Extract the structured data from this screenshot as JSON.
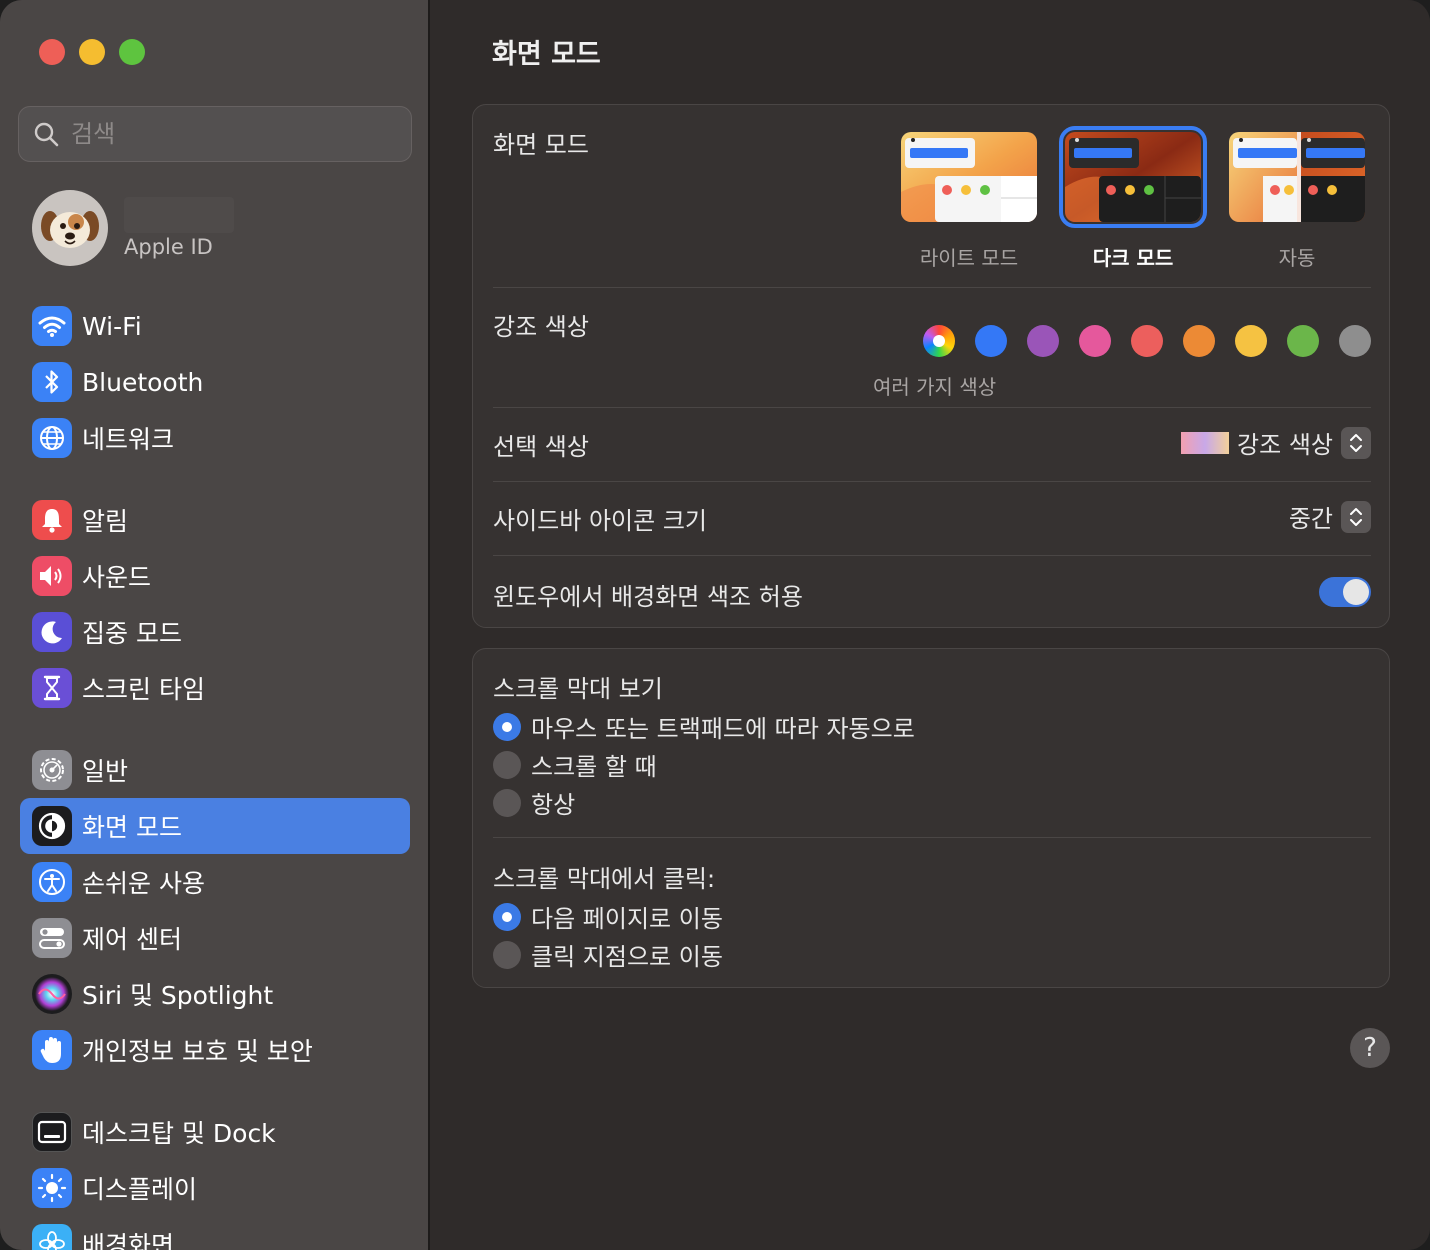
{
  "window": {
    "title": "화면 모드"
  },
  "search": {
    "placeholder": "검색"
  },
  "account": {
    "label": "Apple ID"
  },
  "sidebar": {
    "items": [
      {
        "label": "Wi-Fi",
        "icon": "wifi-icon",
        "color": "#3b82f6"
      },
      {
        "label": "Bluetooth",
        "icon": "bluetooth-icon",
        "color": "#3b82f6"
      },
      {
        "label": "네트워크",
        "icon": "globe-icon",
        "color": "#3b82f6"
      },
      {
        "label": "알림",
        "icon": "bell-icon",
        "color": "#ee4d4d"
      },
      {
        "label": "사운드",
        "icon": "speaker-icon",
        "color": "#ee4d66"
      },
      {
        "label": "집중 모드",
        "icon": "moon-icon",
        "color": "#5a4fd6"
      },
      {
        "label": "스크린 타임",
        "icon": "hourglass-icon",
        "color": "#6a4fd6"
      },
      {
        "label": "일반",
        "icon": "gear-icon",
        "color": "#8e8e93"
      },
      {
        "label": "화면 모드",
        "icon": "appearance-icon",
        "color": "#1c1c1e"
      },
      {
        "label": "손쉬운 사용",
        "icon": "accessibility-icon",
        "color": "#3b82f6"
      },
      {
        "label": "제어 센터",
        "icon": "toggles-icon",
        "color": "#8e8e93"
      },
      {
        "label": "Siri 및 Spotlight",
        "icon": "siri-icon",
        "color": "#a03fd6"
      },
      {
        "label": "개인정보 보호 및 보안",
        "icon": "hand-icon",
        "color": "#3b82f6"
      },
      {
        "label": "데스크탑 및 Dock",
        "icon": "dock-icon",
        "color": "#1c1c1e"
      },
      {
        "label": "디스플레이",
        "icon": "sun-icon",
        "color": "#3b82f6"
      },
      {
        "label": "배경화면",
        "icon": "flower-icon",
        "color": "#3bb0f6"
      }
    ],
    "active_index": 8
  },
  "appearance": {
    "label": "화면 모드",
    "options": [
      {
        "label": "라이트 모드",
        "selected": false
      },
      {
        "label": "다크 모드",
        "selected": true
      },
      {
        "label": "자동",
        "selected": false
      }
    ]
  },
  "accent": {
    "label": "강조 색상",
    "caption": "여러 가지 색상",
    "colors": [
      "multicolor",
      "#3478f6",
      "#9a55b8",
      "#e5589c",
      "#ec5f5d",
      "#ec8a35",
      "#f5c242",
      "#6bb64a",
      "#8e8e8e"
    ]
  },
  "highlight": {
    "label": "선택 색상",
    "value": "강조 색상"
  },
  "sidebar_icon_size": {
    "label": "사이드바 아이콘 크기",
    "value": "중간"
  },
  "wallpaper_tinting": {
    "label": "윈도우에서 배경화면 색조 허용",
    "enabled": true
  },
  "scrollbars": {
    "label": "스크롤 막대 보기",
    "options": [
      {
        "label": "마우스 또는 트랙패드에 따라 자동으로",
        "selected": true
      },
      {
        "label": "스크롤 할 때",
        "selected": false
      },
      {
        "label": "항상",
        "selected": false
      }
    ]
  },
  "scroll_click": {
    "label": "스크롤 막대에서 클릭:",
    "options": [
      {
        "label": "다음 페이지로 이동",
        "selected": true
      },
      {
        "label": "클릭 지점으로 이동",
        "selected": false
      }
    ]
  },
  "help": {
    "label": "?"
  }
}
